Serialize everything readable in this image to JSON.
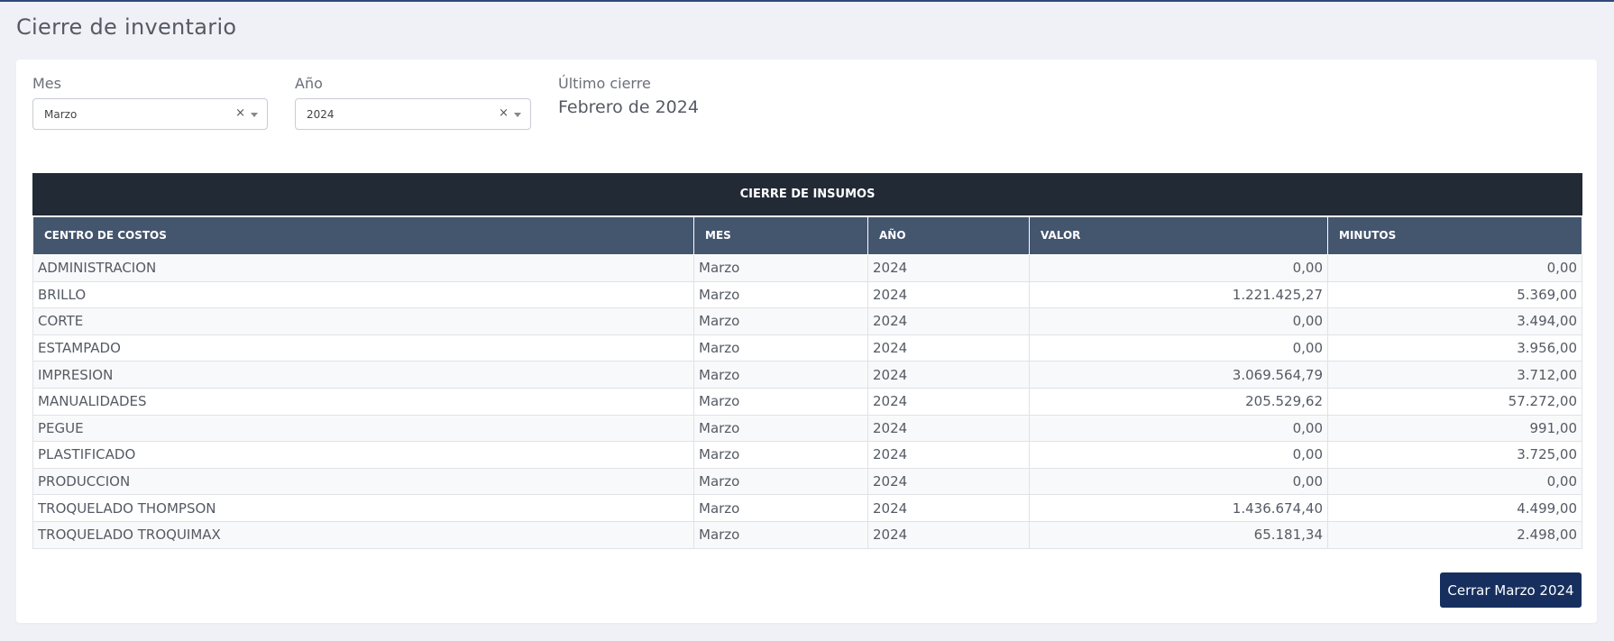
{
  "page": {
    "title": "Cierre de inventario"
  },
  "filters": {
    "mes": {
      "label": "Mes",
      "value": "Marzo",
      "clear": "×"
    },
    "anio": {
      "label": "Año",
      "value": "2024",
      "clear": "×"
    },
    "ultimo_cierre": {
      "label": "Último cierre",
      "value": "Febrero de 2024"
    }
  },
  "table": {
    "caption": "CIERRE DE INSUMOS",
    "columns": [
      "CENTRO DE COSTOS",
      "MES",
      "AÑO",
      "VALOR",
      "MINUTOS"
    ],
    "rows": [
      [
        "ADMINISTRACION",
        "Marzo",
        "2024",
        "0,00",
        "0,00"
      ],
      [
        "BRILLO",
        "Marzo",
        "2024",
        "1.221.425,27",
        "5.369,00"
      ],
      [
        "CORTE",
        "Marzo",
        "2024",
        "0,00",
        "3.494,00"
      ],
      [
        "ESTAMPADO",
        "Marzo",
        "2024",
        "0,00",
        "3.956,00"
      ],
      [
        "IMPRESION",
        "Marzo",
        "2024",
        "3.069.564,79",
        "3.712,00"
      ],
      [
        "MANUALIDADES",
        "Marzo",
        "2024",
        "205.529,62",
        "57.272,00"
      ],
      [
        "PEGUE",
        "Marzo",
        "2024",
        "0,00",
        "991,00"
      ],
      [
        "PLASTIFICADO",
        "Marzo",
        "2024",
        "0,00",
        "3.725,00"
      ],
      [
        "PRODUCCION",
        "Marzo",
        "2024",
        "0,00",
        "0,00"
      ],
      [
        "TROQUELADO THOMPSON",
        "Marzo",
        "2024",
        "1.436.674,40",
        "4.499,00"
      ],
      [
        "TROQUELADO TROQUIMAX",
        "Marzo",
        "2024",
        "65.181,34",
        "2.498,00"
      ]
    ]
  },
  "actions": {
    "close_button": "Cerrar Marzo 2024"
  },
  "colors": {
    "header_dark": "#222a36",
    "header_slate": "#44556e",
    "primary": "#162f5e"
  }
}
